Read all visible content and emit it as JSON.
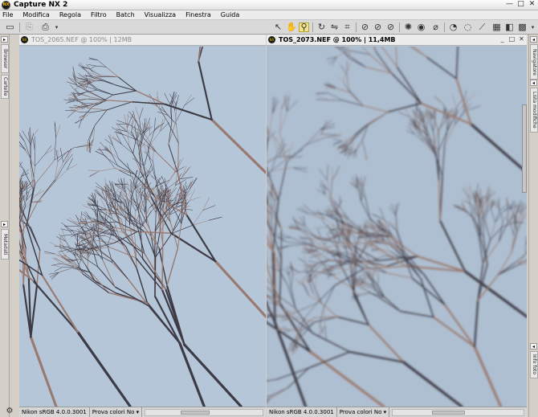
{
  "app": {
    "title": "Capture NX 2",
    "logo_text": "NX"
  },
  "window_controls": {
    "minimize": "—",
    "maximize": "□",
    "close": "✕"
  },
  "menu": [
    "File",
    "Modifica",
    "Regola",
    "Filtro",
    "Batch",
    "Visualizza",
    "Finestra",
    "Guida"
  ],
  "toolbar": {
    "icons": [
      "browser-toggle-icon",
      "camera-icon",
      "print-icon",
      "arrow-icon",
      "hand-icon",
      "zoom-icon",
      "rotate-icon",
      "straighten-icon",
      "crop-icon",
      "black-point-icon",
      "gray-point-icon",
      "white-point-icon",
      "color-control-point-icon",
      "red-eye-icon",
      "retouch-brush-icon",
      "selection-control-point-icon",
      "lasso-icon",
      "brush-icon",
      "gradient-icon",
      "fill-icon"
    ],
    "active_tool": "zoom-icon"
  },
  "left_sidebar": {
    "tabs": [
      "Browser",
      "Cartelle",
      "Metadati"
    ]
  },
  "right_sidebar": {
    "tabs": [
      "Navigatore",
      "Lista modifiche",
      "Info foto"
    ]
  },
  "documents": [
    {
      "title": "TOS_2065.NEF @ 100% | 12MB",
      "active": false,
      "profile": "Nikon sRGB 4.0.0.3001",
      "proof_label": "Prova colori No"
    },
    {
      "title": "TOS_2073.NEF @ 100% | 11,4MB",
      "active": true,
      "profile": "Nikon sRGB 4.0.0.3001",
      "proof_label": "Prova colori No"
    }
  ],
  "colors": {
    "sky_left": "#b4c6d8",
    "sky_right": "#aebfd1",
    "branch_dark": "#3e3a44",
    "branch_warm": "#9a7a70",
    "toolbar_active": "#f1e48d"
  }
}
